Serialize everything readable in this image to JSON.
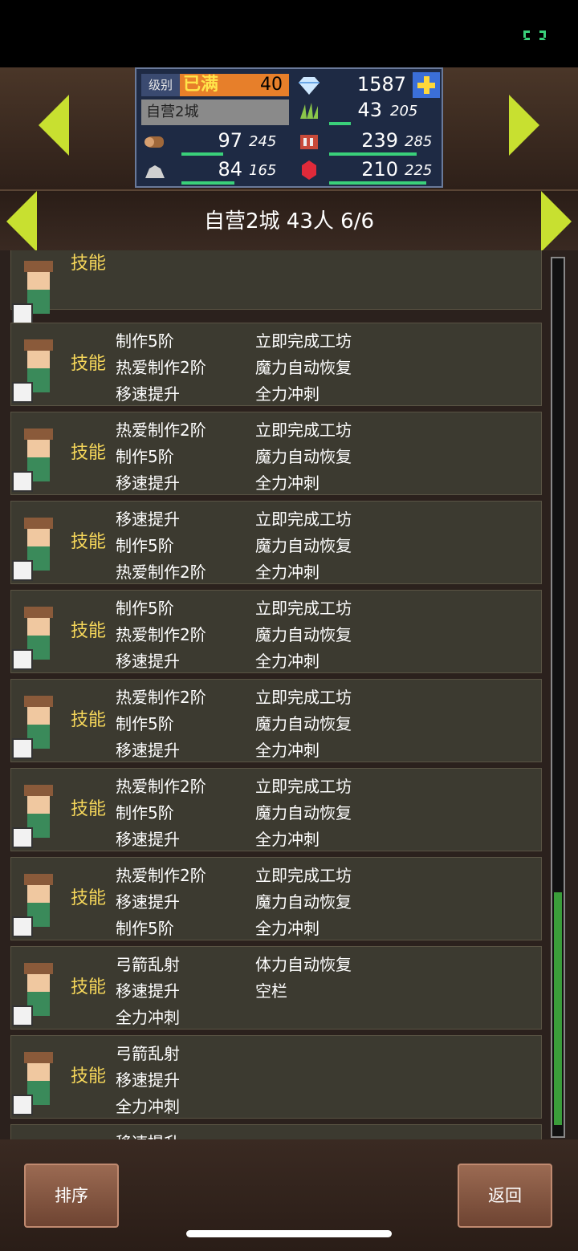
{
  "hud": {
    "level_label": "级别",
    "level_max": "已满",
    "level": "40",
    "gems": "1587",
    "castle_name": "自营2城",
    "grass": {
      "cur": "43",
      "max": "205",
      "fill": 0.21
    },
    "wood": {
      "cur": "97",
      "max": "245",
      "fill": 0.4
    },
    "food": {
      "cur": "239",
      "max": "285",
      "fill": 0.84
    },
    "stone": {
      "cur": "84",
      "max": "165",
      "fill": 0.51
    },
    "mana": {
      "cur": "210",
      "max": "225",
      "fill": 0.93
    }
  },
  "header": {
    "title": "自营2城  43人 6/6"
  },
  "skill_label": "技能",
  "rows": [
    {
      "c1": [],
      "c2": []
    },
    {
      "c1": [
        "制作5阶",
        "热爱制作2阶",
        "移速提升"
      ],
      "c2": [
        "立即完成工坊",
        "魔力自动恢复",
        "全力冲刺"
      ]
    },
    {
      "c1": [
        "热爱制作2阶",
        "制作5阶",
        "移速提升"
      ],
      "c2": [
        "立即完成工坊",
        "魔力自动恢复",
        "全力冲刺"
      ]
    },
    {
      "c1": [
        "移速提升",
        "制作5阶",
        "热爱制作2阶"
      ],
      "c2": [
        "立即完成工坊",
        "魔力自动恢复",
        "全力冲刺"
      ]
    },
    {
      "c1": [
        "制作5阶",
        "热爱制作2阶",
        "移速提升"
      ],
      "c2": [
        "立即完成工坊",
        "魔力自动恢复",
        "全力冲刺"
      ]
    },
    {
      "c1": [
        "热爱制作2阶",
        "制作5阶",
        "移速提升"
      ],
      "c2": [
        "立即完成工坊",
        "魔力自动恢复",
        "全力冲刺"
      ]
    },
    {
      "c1": [
        "热爱制作2阶",
        "制作5阶",
        "移速提升"
      ],
      "c2": [
        "立即完成工坊",
        "魔力自动恢复",
        "全力冲刺"
      ]
    },
    {
      "c1": [
        "热爱制作2阶",
        "移速提升",
        "制作5阶"
      ],
      "c2": [
        "立即完成工坊",
        "魔力自动恢复",
        "全力冲刺"
      ]
    },
    {
      "c1": [
        "弓箭乱射",
        "移速提升",
        "全力冲刺"
      ],
      "c2": [
        "体力自动恢复",
        "空栏"
      ]
    },
    {
      "c1": [
        "弓箭乱射",
        "移速提升",
        "全力冲刺"
      ],
      "c2": []
    },
    {
      "c1": [
        "移速提升"
      ],
      "c2": []
    }
  ],
  "buttons": {
    "sort": "排序",
    "back": "返回"
  }
}
